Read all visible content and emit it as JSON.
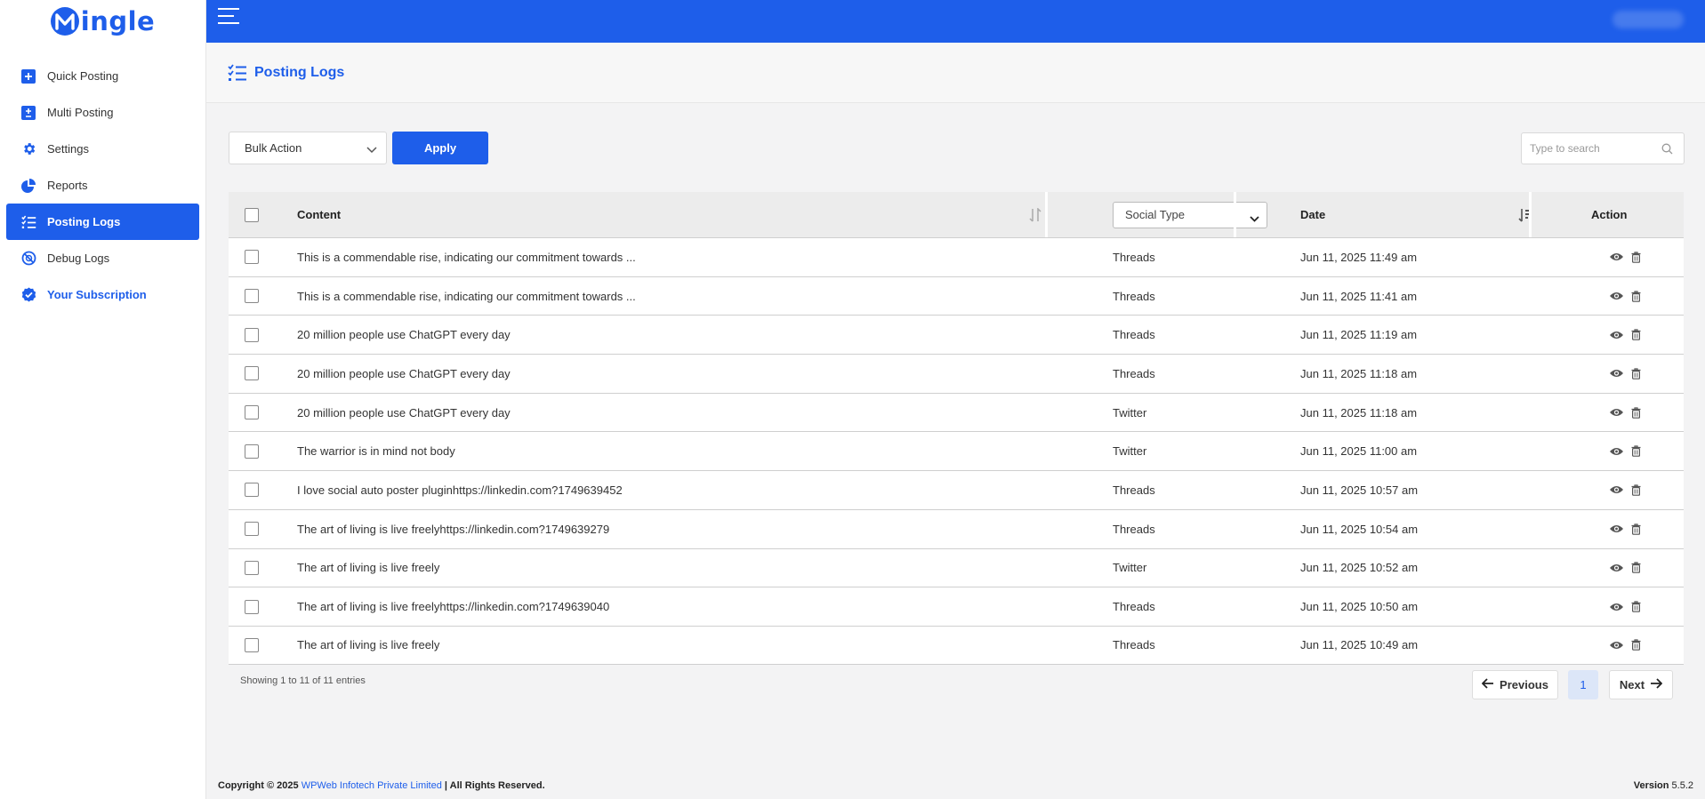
{
  "brand": {
    "name": "ingle",
    "accent_color": "#1e5eea"
  },
  "sidebar": {
    "items": [
      {
        "label": "Quick Posting",
        "icon": "plus-square-icon"
      },
      {
        "label": "Multi Posting",
        "icon": "plus-minus-icon"
      },
      {
        "label": "Settings",
        "icon": "gear-icon"
      },
      {
        "label": "Reports",
        "icon": "pie-chart-icon"
      },
      {
        "label": "Posting Logs",
        "icon": "list-check-icon",
        "active": true
      },
      {
        "label": "Debug Logs",
        "icon": "debug-icon"
      },
      {
        "label": "Your Subscription",
        "icon": "check-badge-icon"
      }
    ]
  },
  "page": {
    "title": "Posting Logs"
  },
  "toolbar": {
    "bulk_action": "Bulk Action",
    "apply_label": "Apply",
    "search_placeholder": "Type to search"
  },
  "table": {
    "headers": {
      "content": "Content",
      "social_type": "Social Type",
      "date": "Date",
      "action": "Action"
    },
    "rows": [
      {
        "content": "This is a commendable rise, indicating our commitment towards ...",
        "social": "Threads",
        "date": "Jun 11, 2025 11:49 am"
      },
      {
        "content": "This is a commendable rise, indicating our commitment towards ...",
        "social": "Threads",
        "date": "Jun 11, 2025 11:41 am"
      },
      {
        "content": "20 million people use ChatGPT every day",
        "social": "Threads",
        "date": "Jun 11, 2025 11:19 am"
      },
      {
        "content": "20 million people use ChatGPT every day",
        "social": "Threads",
        "date": "Jun 11, 2025 11:18 am"
      },
      {
        "content": "20 million people use ChatGPT every day",
        "social": "Twitter",
        "date": "Jun 11, 2025 11:18 am"
      },
      {
        "content": "The warrior is in mind not body",
        "social": "Twitter",
        "date": "Jun 11, 2025 11:00 am"
      },
      {
        "content": "I love social auto poster pluginhttps://linkedin.com?1749639452",
        "social": "Threads",
        "date": "Jun 11, 2025 10:57 am"
      },
      {
        "content": "The art of living is live freelyhttps://linkedin.com?1749639279",
        "social": "Threads",
        "date": "Jun 11, 2025 10:54 am"
      },
      {
        "content": "The art of living is live freely",
        "social": "Twitter",
        "date": "Jun 11, 2025 10:52 am"
      },
      {
        "content": "The art of living is live freelyhttps://linkedin.com?1749639040",
        "social": "Threads",
        "date": "Jun 11, 2025 10:50 am"
      },
      {
        "content": "The art of living is live freely",
        "social": "Threads",
        "date": "Jun 11, 2025 10:49 am"
      }
    ],
    "showing": "Showing 1 to 11 of 11 entries"
  },
  "pagination": {
    "previous": "Previous",
    "current": "1",
    "next": "Next"
  },
  "footer": {
    "copyright_prefix": "Copyright © 2025",
    "company": "WPWeb Infotech Private Limited",
    "rights": "| All Rights Reserved.",
    "version_label": "Version",
    "version": "5.5.2"
  }
}
